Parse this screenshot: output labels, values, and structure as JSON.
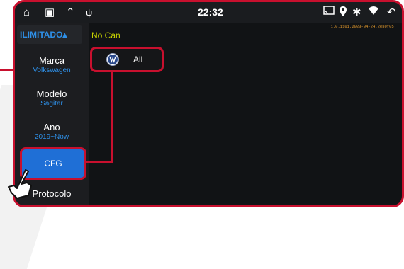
{
  "statusbar": {
    "time": "22:32",
    "left_icons": [
      "home-icon",
      "recent-apps-icon",
      "chevrons-up-icon",
      "usb-icon"
    ],
    "right_icons": [
      "cast-icon",
      "location-icon",
      "bluetooth-icon",
      "wifi-icon",
      "back-icon"
    ]
  },
  "version": "1.0.1101.2023-04-24.2e80f05!",
  "mode_button": {
    "label": "ILIMITADO▴"
  },
  "status_text": "No Can",
  "sidebar": {
    "items": [
      {
        "label": "Marca",
        "value": "Volkswagen"
      },
      {
        "label": "Modelo",
        "value": "Sagitar"
      },
      {
        "label": "Ano",
        "value": "2019~Now"
      },
      {
        "label": "CFG",
        "value": ""
      },
      {
        "label": "Protocolo",
        "value": ""
      }
    ]
  },
  "content": {
    "option": {
      "label": "All",
      "icon": "vw-logo-icon"
    }
  },
  "colors": {
    "accent": "#2e8fe6",
    "highlight": "#c8102e",
    "status": "#c8d400"
  }
}
